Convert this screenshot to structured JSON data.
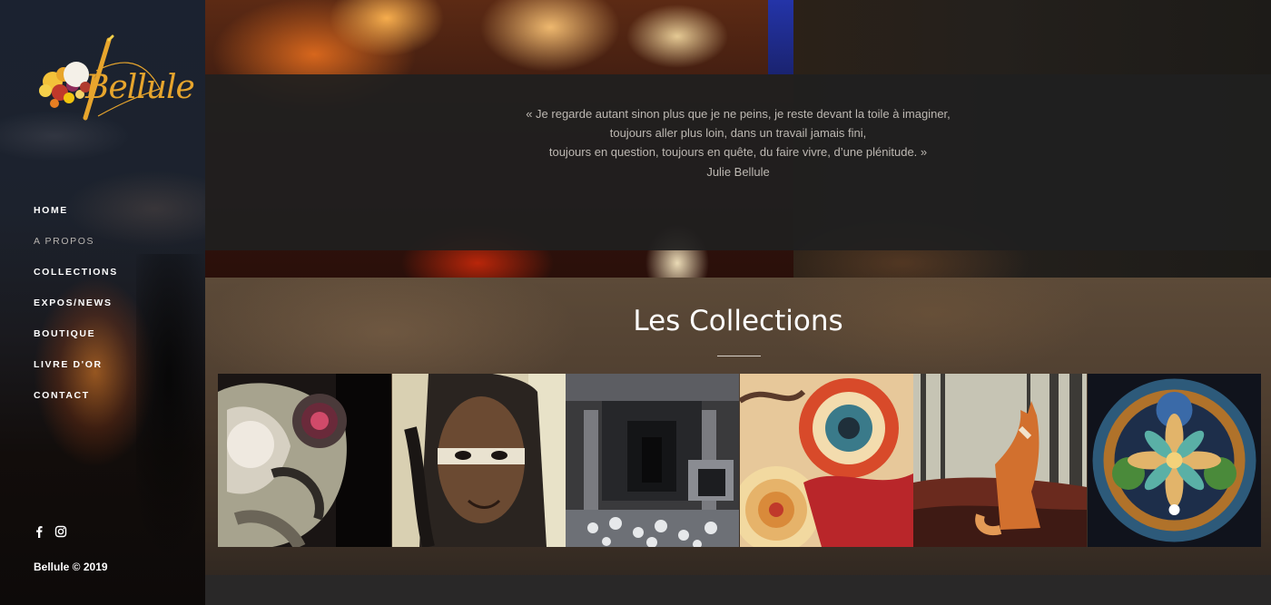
{
  "brand": {
    "name": "Bellule",
    "accent": "#e7a52d"
  },
  "nav": {
    "items": [
      {
        "label": "HOME",
        "active": false
      },
      {
        "label": "A PROPOS",
        "active": true
      },
      {
        "label": "COLLECTIONS",
        "active": false
      },
      {
        "label": "EXPOS/NEWS",
        "active": false
      },
      {
        "label": "BOUTIQUE",
        "active": false
      },
      {
        "label": "LIVRE D'OR",
        "active": false
      },
      {
        "label": "CONTACT",
        "active": false
      }
    ]
  },
  "social": {
    "icons": [
      "facebook-icon",
      "instagram-icon"
    ]
  },
  "footer": {
    "copyright": "Bellule © 2019"
  },
  "hero": {
    "quote_lines": [
      "« Je regarde autant sinon plus que je ne peins, je reste devant la toile à imaginer,",
      "toujours aller plus loin, dans un travail jamais fini,",
      "toujours en question, toujours en quête, du faire vivre, d’une plénitude. »"
    ],
    "quote_author": "Julie Bellule"
  },
  "collections": {
    "title": "Les Collections",
    "tiles": [
      {
        "name": "collection-abstract-face"
      },
      {
        "name": "collection-warrior-portrait"
      },
      {
        "name": "collection-corridor"
      },
      {
        "name": "collection-spiral-shells"
      },
      {
        "name": "collection-fox-forest"
      },
      {
        "name": "collection-mandala"
      }
    ]
  }
}
